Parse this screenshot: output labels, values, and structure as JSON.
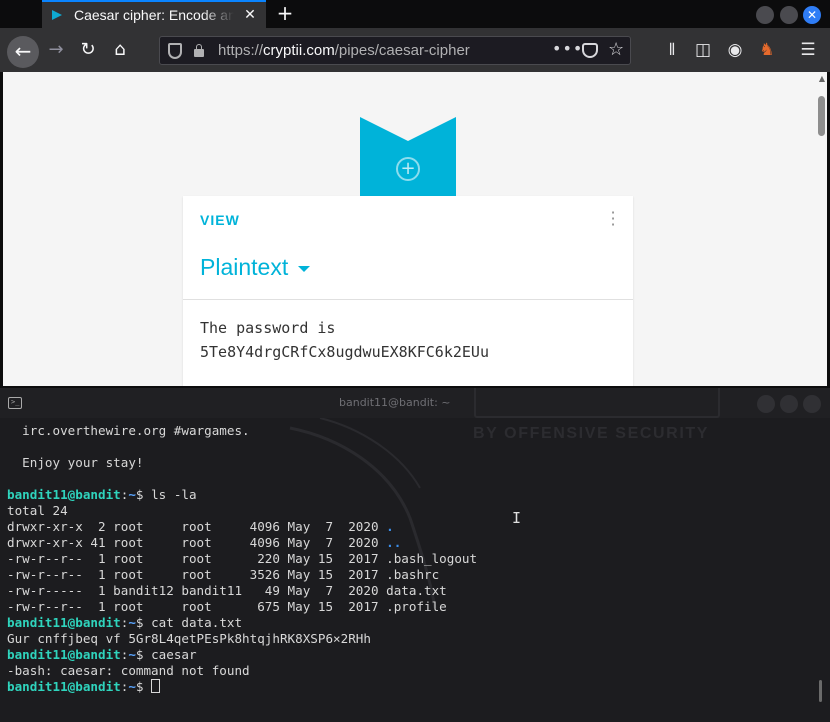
{
  "browser": {
    "tab_title": "Caesar cipher: Encode and",
    "new_tab": "+",
    "tab_close": "✕",
    "url_prefix": "https://",
    "url_host": "cryptii.com",
    "url_path": "/pipes/caesar-cipher"
  },
  "page": {
    "card_kicker": "VIEW",
    "card_title": "Plaintext",
    "card_text": "The password is\n5Te8Y4drgCRfCx8ugdwuEX8KFC6k2EUu"
  },
  "terminal": {
    "title": "bandit11@bandit: ~",
    "watermark": "BY OFFENSIVE SECURITY",
    "motd_1": "  irc.overthewire.org #wargames.",
    "motd_2": "  Enjoy your stay!",
    "prompt_user": "bandit11@bandit",
    "prompt_sep": ":",
    "prompt_dir": "~",
    "prompt_sym": "$ ",
    "cmd_1": "ls -la",
    "total": "total 24",
    "ls_rows": [
      {
        "perm": "drwxr-xr-x  2 root     root     4096 May  7  2020 ",
        "name": "."
      },
      {
        "perm": "drwxr-xr-x 41 root     root     4096 May  7  2020 ",
        "name": ".."
      },
      {
        "perm": "-rw-r--r--  1 root     root      220 May 15  2017 ",
        "name": ".bash_logout"
      },
      {
        "perm": "-rw-r--r--  1 root     root     3526 May 15  2017 ",
        "name": ".bashrc"
      },
      {
        "perm": "-rw-r-----  1 bandit12 bandit11   49 May  7  2020 ",
        "name": "data.txt"
      },
      {
        "perm": "-rw-r--r--  1 root     root      675 May 15  2017 ",
        "name": ".profile"
      }
    ],
    "cmd_2": "cat data.txt",
    "cat_output": "Gur cnffjbeq vf 5Gr8L4qetPEsPk8htqjhRK8XSP6×2RHh",
    "cmd_3": "caesar",
    "error": "-bash: caesar: command not found"
  }
}
